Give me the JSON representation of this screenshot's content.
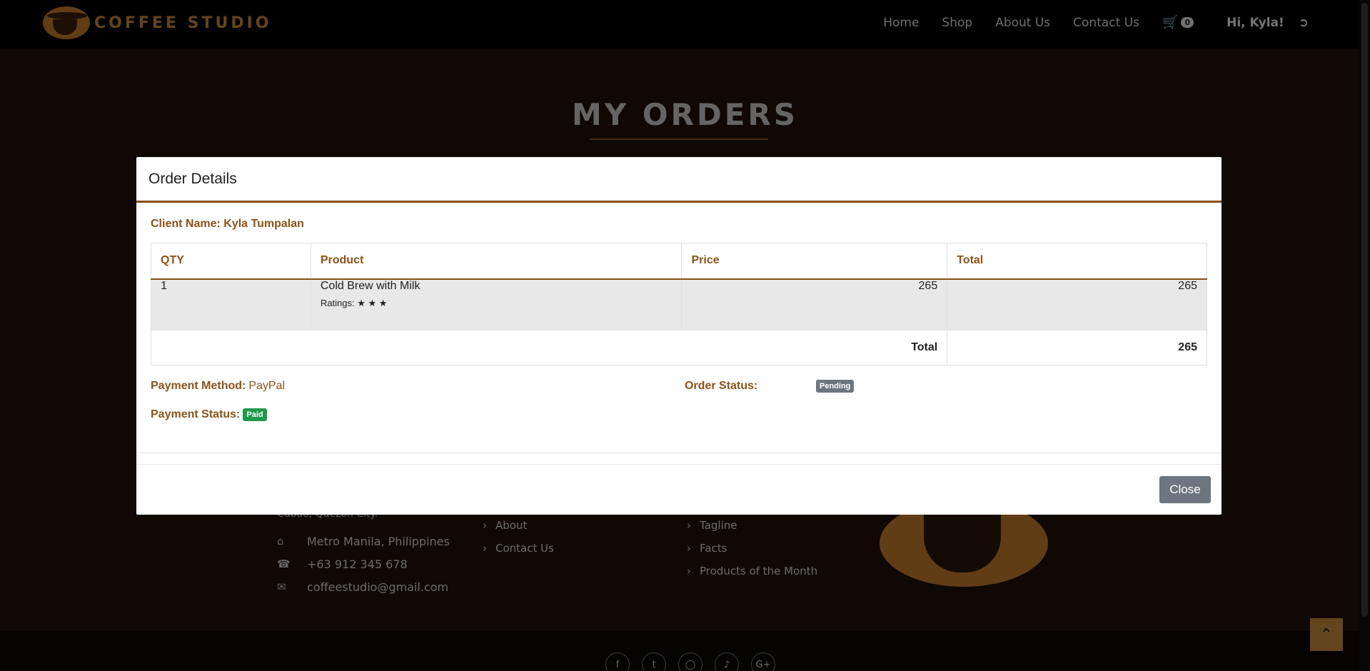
{
  "nav": {
    "brand": "COFFEE STUDIO",
    "links": [
      "Home",
      "Shop",
      "About Us",
      "Contact Us"
    ],
    "cart_count": "0",
    "greeting": "Hi, Kyla!"
  },
  "page": {
    "title": "MY ORDERS"
  },
  "footer": {
    "address_line": "Cubao, Quezon City.",
    "location": "Metro Manila, Philippines",
    "phone": "+63 912 345 678",
    "email": "coffeestudio@gmail.com",
    "links_a": [
      "About",
      "Contact Us"
    ],
    "links_b": [
      "Tagline",
      "Facts",
      "Products of the Month"
    ],
    "socials": [
      "facebook-icon",
      "twitter-icon",
      "instagram-icon",
      "tiktok-icon",
      "google-plus-icon"
    ]
  },
  "modal": {
    "title": "Order Details",
    "client_label": "Client Name:",
    "client_name": "Kyla Tumpalan",
    "columns": [
      "QTY",
      "Product",
      "Price",
      "Total"
    ],
    "items": [
      {
        "qty": "1",
        "product": "Cold Brew with Milk",
        "ratings_label": "Ratings:",
        "stars": "★ ★ ★",
        "price": "265",
        "total": "265"
      }
    ],
    "total_label": "Total",
    "grand_total": "265",
    "payment_method_label": "Payment Method:",
    "payment_method": "PayPal",
    "payment_status_label": "Payment Status:",
    "payment_status": "Paid",
    "order_status_label": "Order Status:",
    "order_status": "Pending",
    "close_label": "Close"
  },
  "colors": {
    "accent": "#8a5318",
    "paid_badge": "#1f9b4a",
    "pending_badge": "#6c7580",
    "close_button": "#6c7580"
  }
}
